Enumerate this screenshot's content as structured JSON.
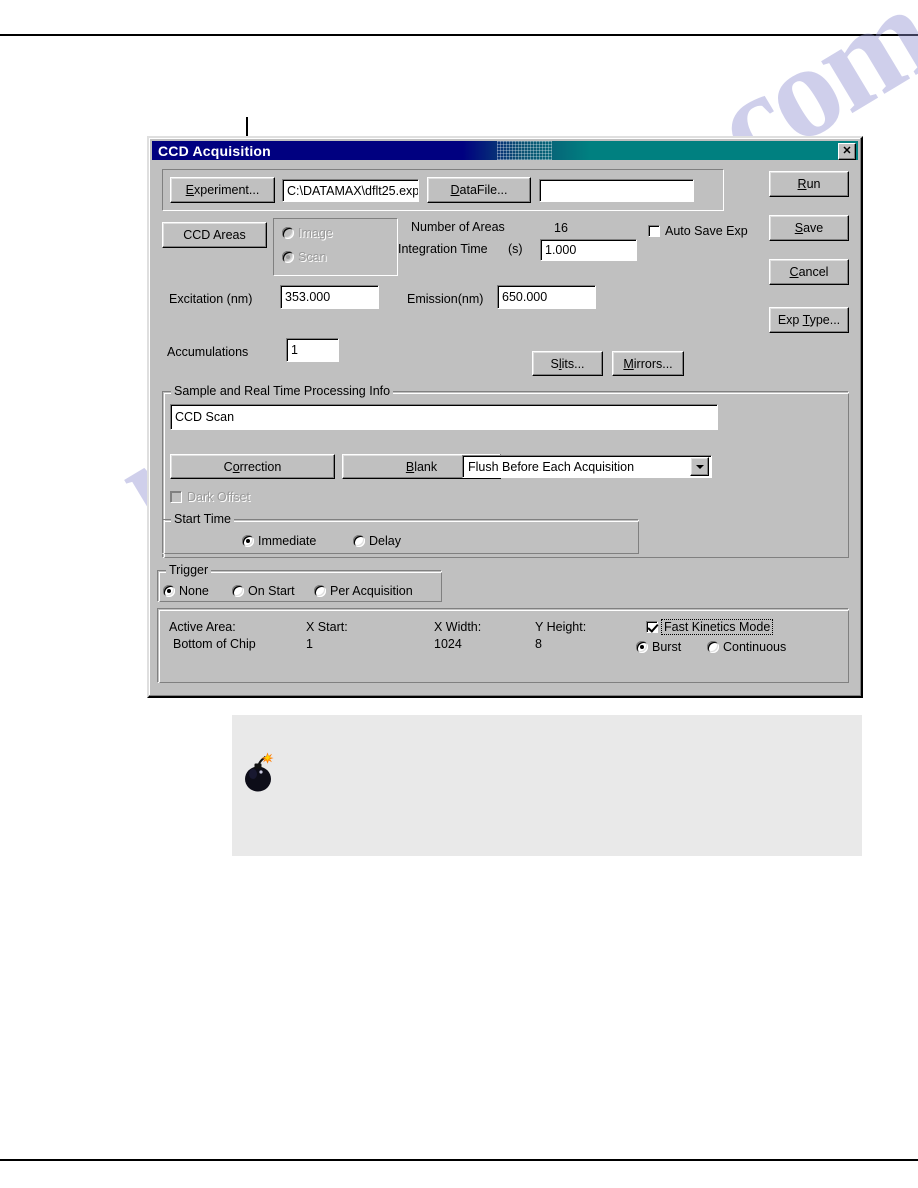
{
  "page": {
    "watermark": "manualshive.com"
  },
  "dialog": {
    "title": "CCD Acquisition",
    "close_label": "✕",
    "toolbar": {
      "experiment_button": "Experiment...",
      "experiment_path": "C:\\DATAMAX\\dflt25.exp",
      "datafile_button": "DataFile...",
      "datafile_value": ""
    },
    "ccd_areas_button": "CCD Areas",
    "mode": {
      "image_label": "Image",
      "scan_label": "Scan",
      "selected": "Scan",
      "disabled": true
    },
    "fields": {
      "number_of_areas_label": "Number of Areas",
      "number_of_areas_value": "16",
      "integration_time_label": "Integration Time",
      "integration_time_units": "(s)",
      "integration_time_value": "1.000",
      "auto_save_exp_label": "Auto Save Exp",
      "auto_save_exp_checked": false,
      "excitation_label": "Excitation (nm)",
      "excitation_value": "353.000",
      "emission_label": "Emission(nm)",
      "emission_value": "650.000",
      "accumulations_label": "Accumulations",
      "accumulations_value": "1"
    },
    "side_buttons": {
      "run": "Run",
      "save": "Save",
      "cancel": "Cancel",
      "exp_type": "Exp Type..."
    },
    "optics_buttons": {
      "slits": "Slits...",
      "mirrors": "Mirrors..."
    },
    "sample_group": {
      "caption": "Sample and Real Time Processing Info",
      "sample_name": "CCD Scan",
      "correction_button": "Correction",
      "blank_button": "Blank",
      "flush_mode": "Flush Before Each Acquisition",
      "dark_offset_label": "Dark Offset",
      "dark_offset_checked": false,
      "dark_offset_disabled": true,
      "start_time": {
        "caption": "Start Time",
        "immediate_label": "Immediate",
        "delay_label": "Delay",
        "selected": "Immediate"
      }
    },
    "trigger_group": {
      "caption": "Trigger",
      "none_label": "None",
      "on_start_label": "On Start",
      "per_acquisition_label": "Per Acquisition",
      "selected": "None"
    },
    "status": {
      "active_area_label": "Active Area:",
      "active_area_value": "Bottom of Chip",
      "x_start_label": "X Start:",
      "x_start_value": "1",
      "x_width_label": "X Width:",
      "x_width_value": "1024",
      "y_height_label": "Y Height:",
      "y_height_value": "8",
      "fast_kinetics_label": "Fast Kinetics Mode",
      "fast_kinetics_checked": true,
      "burst_label": "Burst",
      "continuous_label": "Continuous",
      "kinetics_mode_selected": "Burst"
    }
  },
  "colors": {
    "dialog_face": "#c0c0c0",
    "title_left": "#000080",
    "title_right": "#008080",
    "watermark": "#8e8fd0",
    "note_background": "#e9e9e9"
  }
}
